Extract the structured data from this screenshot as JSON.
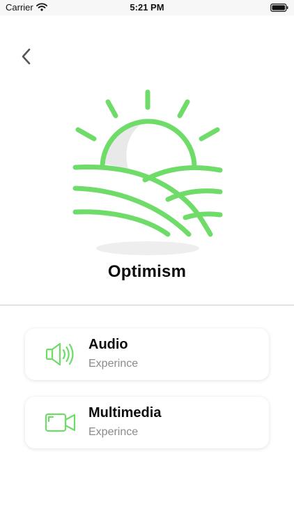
{
  "status_bar": {
    "carrier": "Carrier",
    "time": "5:21 PM"
  },
  "back_icon": "chevron-left-icon",
  "hero_icon": "sunrise-field-icon",
  "title": "Optimism",
  "colors": {
    "accent": "#6fdc6a",
    "accent_dark": "#5cc95a",
    "text": "#0b0b0b",
    "secondary_text": "#8a8a8a",
    "divider": "#cfcfcf"
  },
  "cards": [
    {
      "title": "Audio",
      "subtitle": "Experince",
      "icon": "speaker-icon"
    },
    {
      "title": "Multimedia",
      "subtitle": "Experince",
      "icon": "video-camera-icon"
    }
  ]
}
